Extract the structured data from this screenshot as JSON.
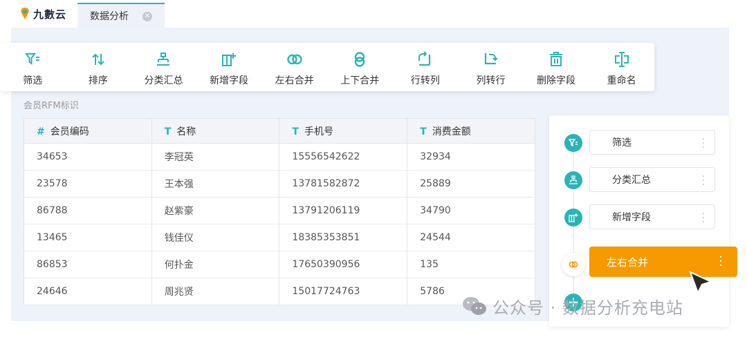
{
  "app": {
    "logo_text": "九數云"
  },
  "tab": {
    "label": "数据分析",
    "close": "✕"
  },
  "toolbar": [
    {
      "icon": "filter-icon",
      "label": "筛选"
    },
    {
      "icon": "sort-icon",
      "label": "排序"
    },
    {
      "icon": "group-summary-icon",
      "label": "分类汇总"
    },
    {
      "icon": "add-field-icon",
      "label": "新增字段"
    },
    {
      "icon": "merge-horizontal-icon",
      "label": "左右合并"
    },
    {
      "icon": "merge-vertical-icon",
      "label": "上下合并"
    },
    {
      "icon": "row-to-column-icon",
      "label": "行转列"
    },
    {
      "icon": "column-to-row-icon",
      "label": "列转行"
    },
    {
      "icon": "delete-field-icon",
      "label": "删除字段"
    },
    {
      "icon": "rename-icon",
      "label": "重命名"
    }
  ],
  "section_label": "会员RFM标识",
  "table": {
    "headers": [
      {
        "icon": "#",
        "label": "会员编码"
      },
      {
        "icon": "T",
        "label": "名称"
      },
      {
        "icon": "T",
        "label": "手机号"
      },
      {
        "icon": "T",
        "label": "消费金额"
      }
    ],
    "rows": [
      [
        "34653",
        "李冠英",
        "15556542622",
        "32934"
      ],
      [
        "23578",
        "王本强",
        "13781582872",
        "25889"
      ],
      [
        "86788",
        "赵紫豪",
        "13791206119",
        "34790"
      ],
      [
        "13465",
        "钱佳仪",
        "18385353851",
        "24544"
      ],
      [
        "86853",
        "何扑金",
        "17650390956",
        "135"
      ],
      [
        "24646",
        "周兆贤",
        "15017724763",
        "5786"
      ]
    ]
  },
  "flow": {
    "steps": [
      {
        "label": "筛选"
      },
      {
        "label": "分类汇总"
      },
      {
        "label": "新增字段"
      },
      {
        "label": "左右合并"
      }
    ],
    "add": "+"
  },
  "watermark": "公众号 · 数据分析充电站",
  "colors": {
    "accent": "#2bb3b6",
    "active": "#f59a00"
  }
}
